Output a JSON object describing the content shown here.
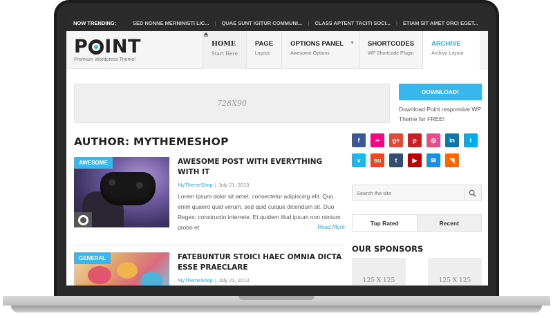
{
  "trending": {
    "label": "NOW TRENDING:",
    "items": [
      "SED NONNE MERNINISTI LIC...",
      "QUAE SUNT IGITUR COMMUNI...",
      "CLASS APTENT TACITI SOCI...",
      "ETIAM SIT AMET ORCI EGET..."
    ]
  },
  "logo": {
    "part1": "P",
    "part2": "INT",
    "tagline": "Premium Wordpress Theme!",
    "accent": "#38b7ee"
  },
  "nav": [
    {
      "main": "Home",
      "sub": "Start Here",
      "icon": "home-icon"
    },
    {
      "main": "Page",
      "sub": "Layout"
    },
    {
      "main": "Options Panel",
      "sub": "Awesome Options",
      "icon": "caret-down-icon"
    },
    {
      "main": "Shortcodes",
      "sub": "WP Shortcode Plugin"
    },
    {
      "main": "Archive",
      "sub": "Archive Layout"
    }
  ],
  "ad": {
    "label": "728X90"
  },
  "download": {
    "button": "DOWNLOAD!",
    "text": "Download Point responsive WP Theme for FREE!"
  },
  "page_title": "Author: MyThemeShop",
  "posts": [
    {
      "category": "Awesome",
      "title": "Awesome Post With Everything With It",
      "author": "MyThemeShop",
      "date": "July 21, 2013",
      "excerpt": "Lorem ipsum dolor sit amet, consectetur adipiscing elit. Quo enim quaero quid verum, sed quid cuique dicendum sit. Duo Reges: constructio interrete. Et quidem illud ipsum non nimium probo et",
      "read_more": "Read More"
    },
    {
      "category": "General",
      "title": "Fatebuntur Stoici haec omnia dicta esse praeclare",
      "author": "MyThemeShop",
      "date": "July 21, 2013"
    }
  ],
  "social": [
    {
      "name": "facebook-icon",
      "glyph": "f",
      "color": "#3b5998"
    },
    {
      "name": "flickr-icon",
      "glyph": "••",
      "color": "#ff0084"
    },
    {
      "name": "google-plus-icon",
      "glyph": "g+",
      "color": "#dd4b39"
    },
    {
      "name": "pinterest-icon",
      "glyph": "p",
      "color": "#cb2027"
    },
    {
      "name": "dribbble-icon",
      "glyph": "◎",
      "color": "#ea4c89"
    },
    {
      "name": "linkedin-icon",
      "glyph": "in",
      "color": "#0e76a8"
    },
    {
      "name": "twitter-icon",
      "glyph": "t",
      "color": "#00aced"
    },
    {
      "name": "vimeo-icon",
      "glyph": "v",
      "color": "#1ab7ea"
    },
    {
      "name": "stumbleupon-icon",
      "glyph": "su",
      "color": "#eb4924"
    },
    {
      "name": "tumblr-icon",
      "glyph": "t",
      "color": "#32506d"
    },
    {
      "name": "youtube-icon",
      "glyph": "▶",
      "color": "#bb0000"
    },
    {
      "name": "email-icon",
      "glyph": "✉",
      "color": "#1d90dd"
    },
    {
      "name": "rss-icon",
      "glyph": "◥",
      "color": "#ff6600"
    }
  ],
  "search": {
    "placeholder": "Search the site"
  },
  "tabs": [
    "Top Rated",
    "Recent"
  ],
  "sponsors": {
    "title": "Our Sponsors",
    "items": [
      "125 X 125",
      "125 X 125"
    ]
  }
}
